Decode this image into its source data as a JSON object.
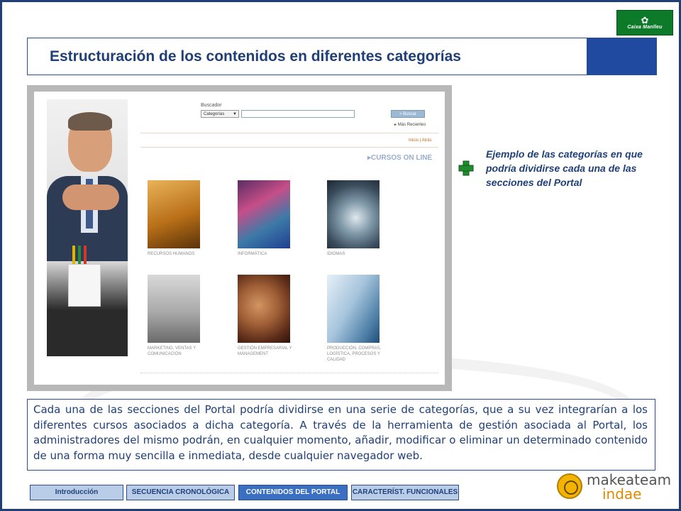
{
  "header": {
    "title": "Estructuración de los contenidos en diferentes categorías",
    "logo_text": "Caixa Manlleu"
  },
  "screenshot": {
    "search_label": "Buscador",
    "category_select": "Categorías",
    "search_button": "> Buscar",
    "recent_link": "Más Recientes",
    "breadcrumb": "Inicio | Atrás",
    "section_title": "CURSOS ON LINE",
    "categories": [
      {
        "label": "RECURSOS HUMANOS"
      },
      {
        "label": "INFORMÁTICA"
      },
      {
        "label": "IDIOMAS"
      },
      {
        "label": "MARKETING, VENTAS Y COMUNICACIÓN"
      },
      {
        "label": "GESTIÓN EMPRESARIAL Y MANAGEMENT"
      },
      {
        "label": "PRODUCCIÓN, COMPRAS, LOGÍSTICA, PROCESOS Y CALIDAD"
      }
    ]
  },
  "caption": "Ejemplo de las categorías en que podría dividirse cada una de las secciones del Portal",
  "description": "Cada una de las secciones del Portal podría dividirse en una serie de categorías, que a su vez integrarían a los diferentes cursos asociados a dicha categoría. A través de la herramienta de gestión asociada al Portal, los administradores del mismo podrán, en cualquier momento, añadir, modificar o eliminar un determinado contenido de una forma muy sencilla e inmediata, desde cualquier navegador web.",
  "nav": {
    "tabs": [
      {
        "label": "Introducción",
        "active": false
      },
      {
        "label": "SECUENCIA CRONOLÓGICA",
        "active": false
      },
      {
        "label": "CONTENIDOS DEL PORTAL",
        "active": true
      },
      {
        "label": "CARACTERÍST. FUNCIONALES",
        "active": false
      }
    ]
  },
  "brand": {
    "line1": "makeateam",
    "line2": "indae"
  },
  "colors": {
    "primary": "#1f3f78",
    "accent": "#1f4aa0",
    "tab": "#b9cde8",
    "tab_active": "#3b6fc1",
    "plus": "#1f8a2e"
  }
}
